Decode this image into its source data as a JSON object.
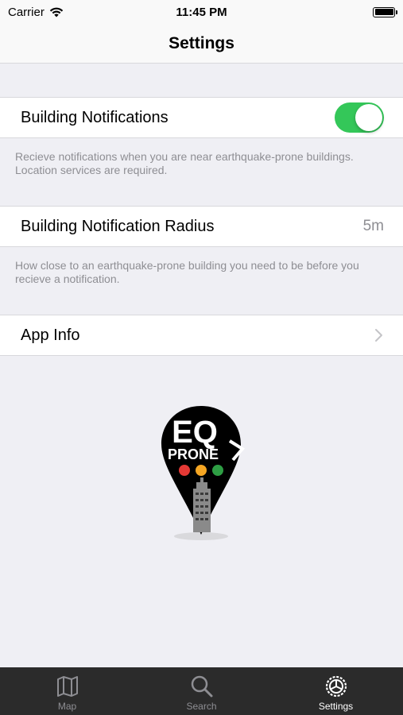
{
  "status_bar": {
    "carrier": "Carrier",
    "time": "11:45 PM",
    "wifi_icon": "wifi-icon",
    "battery_icon": "battery-icon"
  },
  "nav": {
    "title": "Settings"
  },
  "settings": {
    "building_notifications": {
      "label": "Building Notifications",
      "enabled": true,
      "footer": "Recieve notifications when you are near earthquake-prone buildings. Location services are required."
    },
    "radius": {
      "label": "Building Notification Radius",
      "value": "5m",
      "footer": "How close to an earthquake-prone building you need to be before you recieve a notification."
    },
    "app_info": {
      "label": "App Info",
      "chevron_icon": "chevron-right-icon"
    }
  },
  "logo": {
    "text_line1": "EQ",
    "text_line2": "PRONE",
    "dot_colors": [
      "#e53935",
      "#f5a623",
      "#2e9e44"
    ]
  },
  "tab_bar": {
    "tabs": [
      {
        "label": "Map",
        "icon": "map-icon",
        "active": false
      },
      {
        "label": "Search",
        "icon": "search-icon",
        "active": false
      },
      {
        "label": "Settings",
        "icon": "settings-icon",
        "active": true
      }
    ]
  },
  "colors": {
    "toggle_on": "#34c759",
    "background": "#efeff4",
    "tab_bar": "#2b2b2b"
  }
}
